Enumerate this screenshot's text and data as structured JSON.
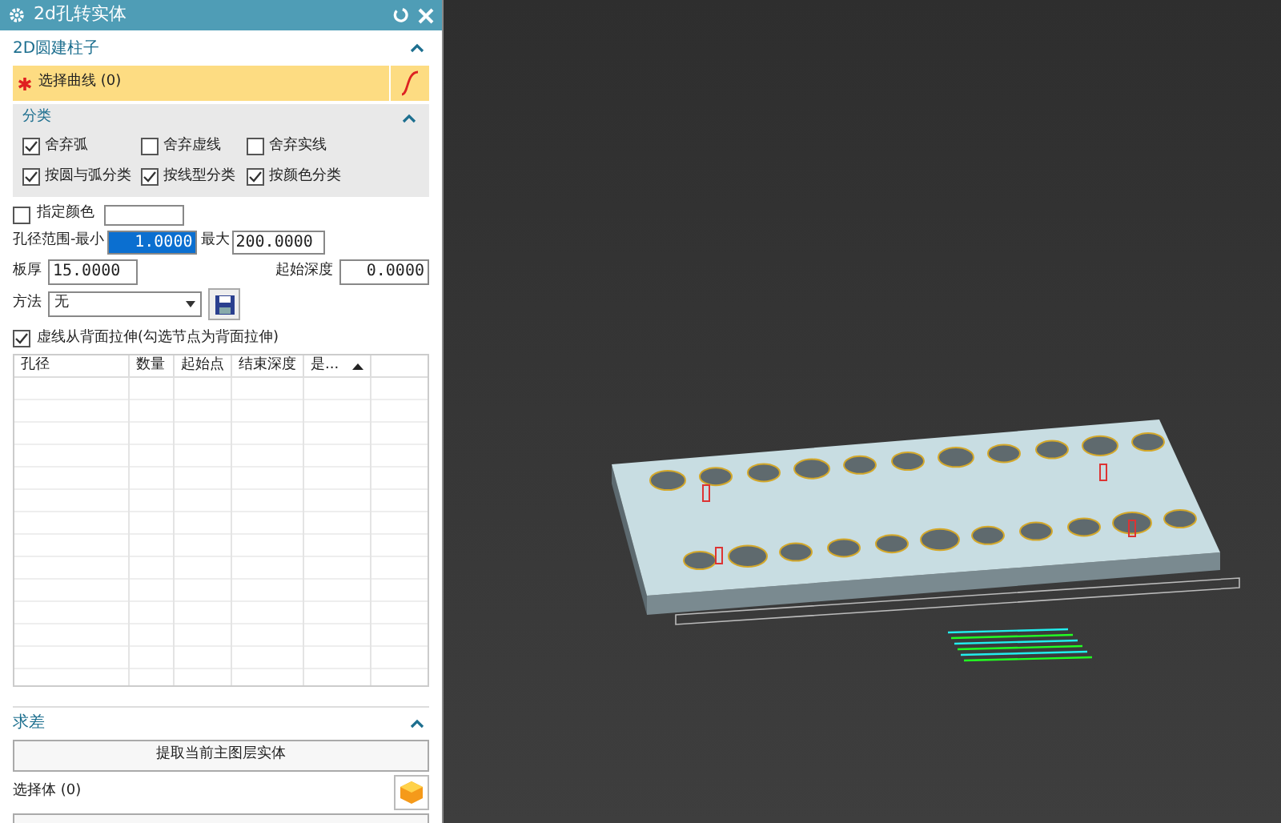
{
  "window": {
    "title": "2d孔转实体"
  },
  "section_main": {
    "title": "2D圆建柱子",
    "expanded": true
  },
  "select_curve": {
    "label": "选择曲线 (0)"
  },
  "category": {
    "title": "分类",
    "expanded": true,
    "options": [
      {
        "label": "舍弃弧",
        "checked": true
      },
      {
        "label": "舍弃虚线",
        "checked": false
      },
      {
        "label": "舍弃实线",
        "checked": false
      },
      {
        "label": "按圆与弧分类",
        "checked": true
      },
      {
        "label": "按线型分类",
        "checked": true
      },
      {
        "label": "按颜色分类",
        "checked": true
      }
    ]
  },
  "specify_color": {
    "label": "指定颜色",
    "checked": false
  },
  "hole_range": {
    "label": "孔径范围-最小",
    "min": "1.0000",
    "max_label": "最大",
    "max": "200.0000"
  },
  "plate": {
    "label": "板厚",
    "value": "15.0000"
  },
  "start_depth": {
    "label": "起始深度",
    "value": "0.0000"
  },
  "method": {
    "label": "方法",
    "value": "无"
  },
  "dashed_back": {
    "label": "虚线从背面拉伸(勾选节点为背面拉伸)",
    "checked": true
  },
  "table": {
    "columns": [
      "孔径",
      "数量",
      "起始点",
      "结束深度",
      "是..."
    ]
  },
  "section_diff": {
    "title": "求差",
    "expanded": true,
    "button": "提取当前主图层实体",
    "select_body": "选择体 (0)"
  }
}
